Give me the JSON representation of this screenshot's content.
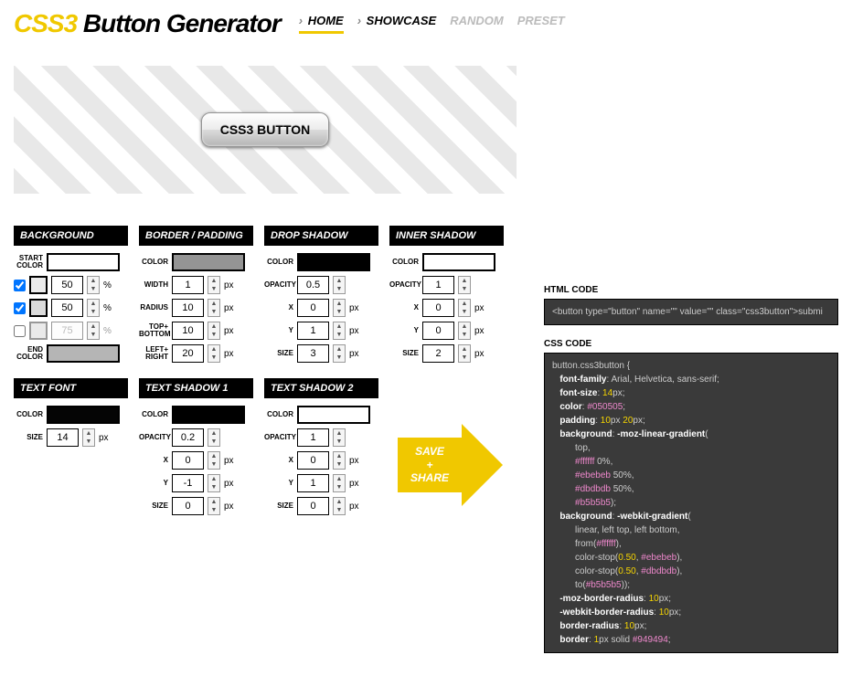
{
  "header": {
    "logo_css3": "CSS3",
    "logo_rest": " Button Generator",
    "nav": [
      {
        "label": "HOME",
        "active": true,
        "caret": true
      },
      {
        "label": "SHOWCASE",
        "active": false,
        "caret": true
      },
      {
        "label": "RANDOM",
        "muted": true
      },
      {
        "label": "PRESET",
        "muted": true
      }
    ]
  },
  "preview_button": "CSS3 BUTTON",
  "panels": {
    "background": {
      "title": "BACKGROUND",
      "start_color_label": "START\nCOLOR",
      "start_color": "#ffffff",
      "stop1": {
        "checked": true,
        "color": "#ebebeb",
        "val": "50"
      },
      "stop2": {
        "checked": true,
        "color": "#dbdbdb",
        "val": "50"
      },
      "stop3": {
        "checked": false,
        "color": "#cccccc",
        "val": "75"
      },
      "end_color_label": "END\nCOLOR",
      "end_color": "#b5b5b5"
    },
    "border": {
      "title": "BORDER / PADDING",
      "color_label": "COLOR",
      "color": "#949494",
      "width_label": "WIDTH",
      "width": "1",
      "radius_label": "RADIUS",
      "radius": "10",
      "topbot_label": "TOP+\nBOTTOM",
      "topbot": "10",
      "leftright_label": "LEFT+\nRIGHT",
      "leftright": "20"
    },
    "dropshadow": {
      "title": "DROP SHADOW",
      "color_label": "COLOR",
      "color": "#000000",
      "opacity_label": "OPACITY",
      "opacity": "0.5",
      "x_label": "X",
      "x": "0",
      "y_label": "Y",
      "y": "1",
      "size_label": "SIZE",
      "size": "3"
    },
    "innershadow": {
      "title": "INNER SHADOW",
      "color_label": "COLOR",
      "color": "#ffffff",
      "opacity_label": "OPACITY",
      "opacity": "1",
      "x_label": "X",
      "x": "0",
      "y_label": "Y",
      "y": "0",
      "size_label": "SIZE",
      "size": "2"
    },
    "textfont": {
      "title": "TEXT FONT",
      "color_label": "COLOR",
      "color": "#050505",
      "size_label": "SIZE",
      "size": "14"
    },
    "textshadow1": {
      "title": "TEXT SHADOW 1",
      "color_label": "COLOR",
      "color": "#000000",
      "opacity_label": "OPACITY",
      "opacity": "0.2",
      "x_label": "X",
      "x": "0",
      "y_label": "Y",
      "y": "-1",
      "size_label": "SIZE",
      "size": "0"
    },
    "textshadow2": {
      "title": "TEXT SHADOW 2",
      "color_label": "COLOR",
      "color": "#ffffff",
      "opacity_label": "OPACITY",
      "opacity": "1",
      "x_label": "X",
      "x": "0",
      "y_label": "Y",
      "y": "1",
      "size_label": "SIZE",
      "size": "0"
    }
  },
  "save_share": {
    "line1": "SAVE",
    "line2": "+",
    "line3": "SHARE"
  },
  "code": {
    "html_label": "HTML CODE",
    "html_code": "<button type=\"button\" name=\"\" value=\"\" class=\"css3button\">submi",
    "css_label": "CSS CODE"
  }
}
